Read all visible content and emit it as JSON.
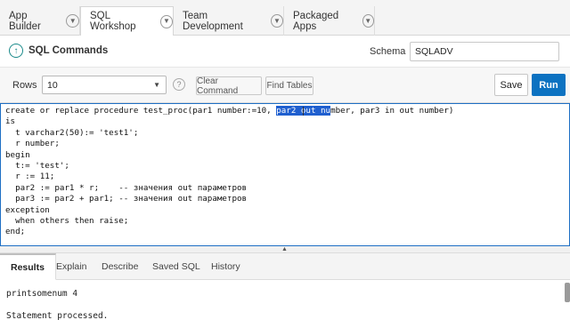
{
  "top_tabs": [
    {
      "label": "App Builder",
      "active": false
    },
    {
      "label": "SQL Workshop",
      "active": true
    },
    {
      "label": "Team Development",
      "active": false
    },
    {
      "label": "Packaged Apps",
      "active": false
    }
  ],
  "header": {
    "title": "SQL Commands",
    "schema_label": "Schema",
    "schema_value": "SQLADV"
  },
  "toolbar": {
    "rows_label": "Rows",
    "rows_value": "10",
    "clear_command": "Clear Command",
    "find_tables": "Find Tables",
    "save": "Save",
    "run": "Run"
  },
  "editor": {
    "line1_before": "create or replace procedure test_proc(par1 number:=10, ",
    "line1_selected": "par2 out nu",
    "line1_after": "mber, par3 in out number)",
    "lines": [
      "is",
      "  t varchar2(50):= 'test1';",
      "  r number;",
      "begin",
      "  t:= 'test';",
      "  r := 11;",
      "  par2 := par1 * r;    -- значения out параметров",
      "  par3 := par2 + par1; -- значения out параметров",
      "exception",
      "  when others then raise;",
      "end;"
    ]
  },
  "result_tabs": [
    "Results",
    "Explain",
    "Describe",
    "Saved SQL",
    "History"
  ],
  "output": {
    "line1": "printsomenum 4",
    "line2": "Statement processed."
  },
  "colors": {
    "accent": "#0c72c1",
    "selection": "#1f5fcf",
    "editor_border": "#1e6fc4"
  },
  "icons": {
    "tab_chevron": "chevron-down-icon",
    "header": "up-arrow-circle-icon",
    "help": "help-icon"
  }
}
